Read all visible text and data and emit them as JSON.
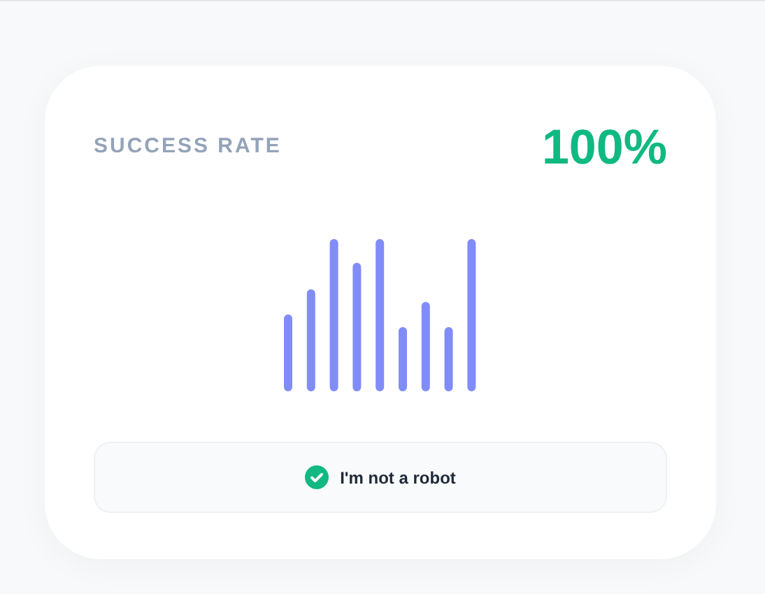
{
  "card": {
    "title": "SUCCESS RATE",
    "value": "100%"
  },
  "captcha": {
    "label": "I'm not a robot",
    "checked": true
  }
}
